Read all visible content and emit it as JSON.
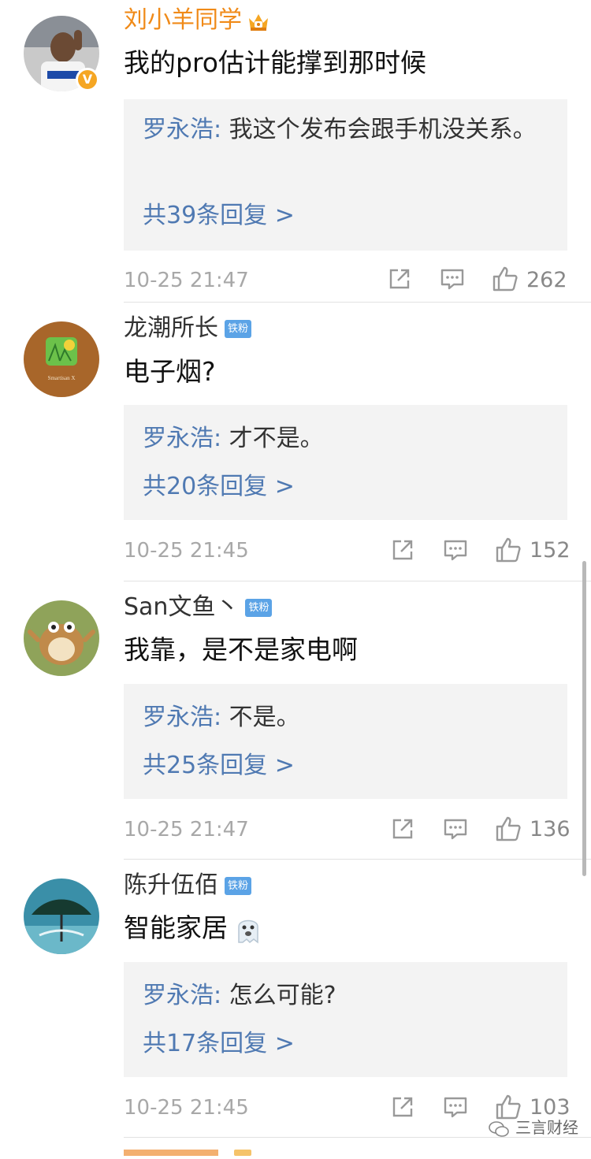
{
  "comments": [
    {
      "username": "刘小羊同学",
      "text": "我的pro估计能撑到那时候",
      "reply_author": "罗永浩:",
      "reply_text": " 我这个发布会跟手机没关系。",
      "reply_count": "共39条回复 >",
      "time": "10-25 21:47",
      "likes": "262",
      "verified": "V"
    },
    {
      "username": "龙潮所长",
      "badge": "铁粉",
      "text": "电子烟?",
      "reply_author": "罗永浩:",
      "reply_text": " 才不是。",
      "reply_count": "共20条回复 >",
      "time": "10-25 21:45",
      "likes": "152",
      "avatar_text": "Smartisan X"
    },
    {
      "username": "San文鱼丶",
      "badge": "铁粉",
      "text": "我靠，是不是家电啊",
      "reply_author": "罗永浩:",
      "reply_text": " 不是。",
      "reply_count": "共25条回复 >",
      "time": "10-25 21:47",
      "likes": "136"
    },
    {
      "username": "陈升伍佰",
      "badge": "铁粉",
      "text": "智能家居",
      "reply_author": "罗永浩:",
      "reply_text": " 怎么可能?",
      "reply_count": "共17条回复 >",
      "time": "10-25 21:45",
      "likes": "103"
    }
  ],
  "watermark": "三言财经",
  "colors": {
    "link_blue": "#4f79b2",
    "vip_orange": "#f08a18",
    "badge_blue": "#5ba3e6",
    "reply_bg": "#f3f3f3",
    "meta_grey": "#a8a8a8"
  },
  "icons": [
    "share-icon",
    "comment-icon",
    "like-icon",
    "crown-icon",
    "verified-icon",
    "wechat-icon"
  ]
}
